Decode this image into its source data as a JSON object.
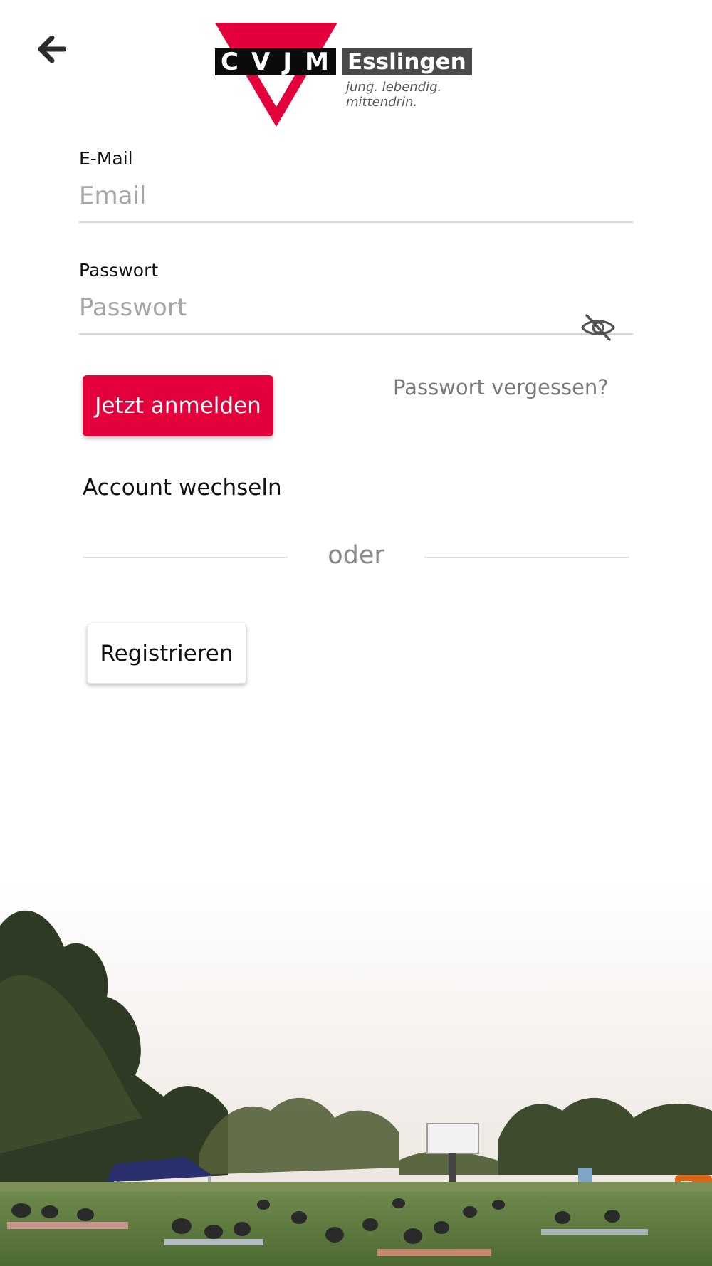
{
  "header": {
    "back_icon": "arrow-left-icon",
    "logo": {
      "brand": "CVJM",
      "city": "Esslingen",
      "tagline": "jung. lebendig. mittendrin.",
      "colors": {
        "red": "#e4003a",
        "black": "#0b0b0b",
        "gray": "#4a4a4a"
      }
    }
  },
  "form": {
    "email": {
      "label": "E-Mail",
      "placeholder": "Email",
      "value": ""
    },
    "password": {
      "label": "Passwort",
      "placeholder": "Passwort",
      "value": "",
      "toggle_icon": "eye-slash-icon"
    },
    "login_button": "Jetzt anmelden",
    "forgot_link": "Passwort vergessen?",
    "switch_account": "Account wechseln",
    "divider": "oder",
    "register_button": "Registrieren"
  },
  "colors": {
    "accent": "#e4003a",
    "muted_text": "#7a7a7a",
    "underline": "#d6d6d6"
  },
  "background_image": "outdoor-cinema-photo"
}
